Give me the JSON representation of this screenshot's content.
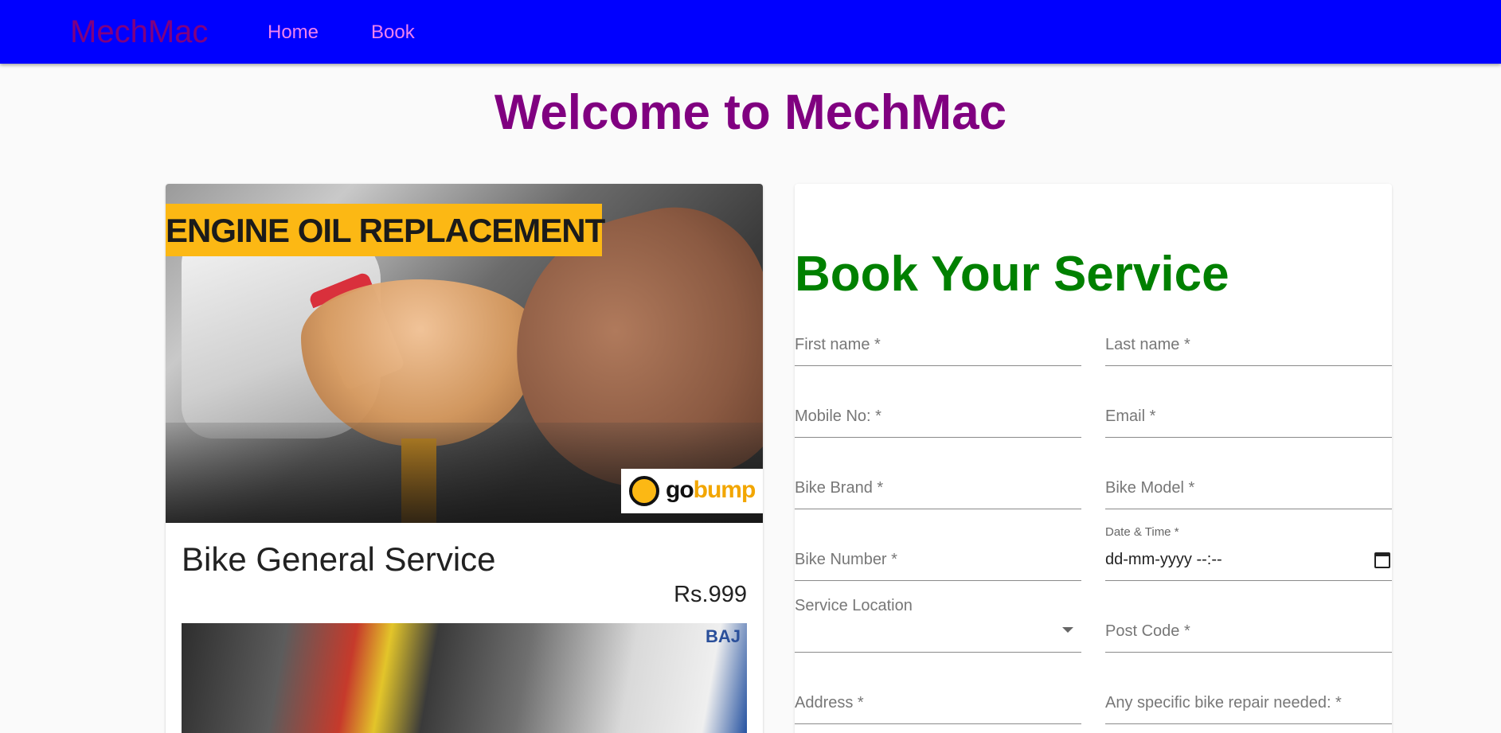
{
  "navbar": {
    "brand": "MechMac",
    "links": [
      "Home",
      "Book"
    ]
  },
  "page": {
    "welcome": "Welcome to MechMac"
  },
  "service_card": {
    "image_banner": "ENGINE OIL REPLACEMENT",
    "image_logo_left": "go",
    "image_logo_right": "bump",
    "title": "Bike General Service",
    "price": "Rs.999",
    "second_image_label": "BAJ"
  },
  "form": {
    "title": "Book Your Service",
    "first_name": "First name *",
    "last_name": "Last name *",
    "mobile": "Mobile No: *",
    "email": "Email *",
    "bike_brand": "Bike Brand *",
    "bike_model": "Bike Model *",
    "bike_number": "Bike Number *",
    "datetime_label": "Date & Time *",
    "datetime_value": "dd-mm-yyyy --:--",
    "service_location": "Service Location",
    "post_code": "Post Code *",
    "address": "Address *",
    "repair": "Any specific bike repair needed: *"
  },
  "colors": {
    "navbar": "#0000ff",
    "brand": "#800080",
    "nav_link": "#ee82ee",
    "welcome": "#800080",
    "form_title": "#008000"
  }
}
